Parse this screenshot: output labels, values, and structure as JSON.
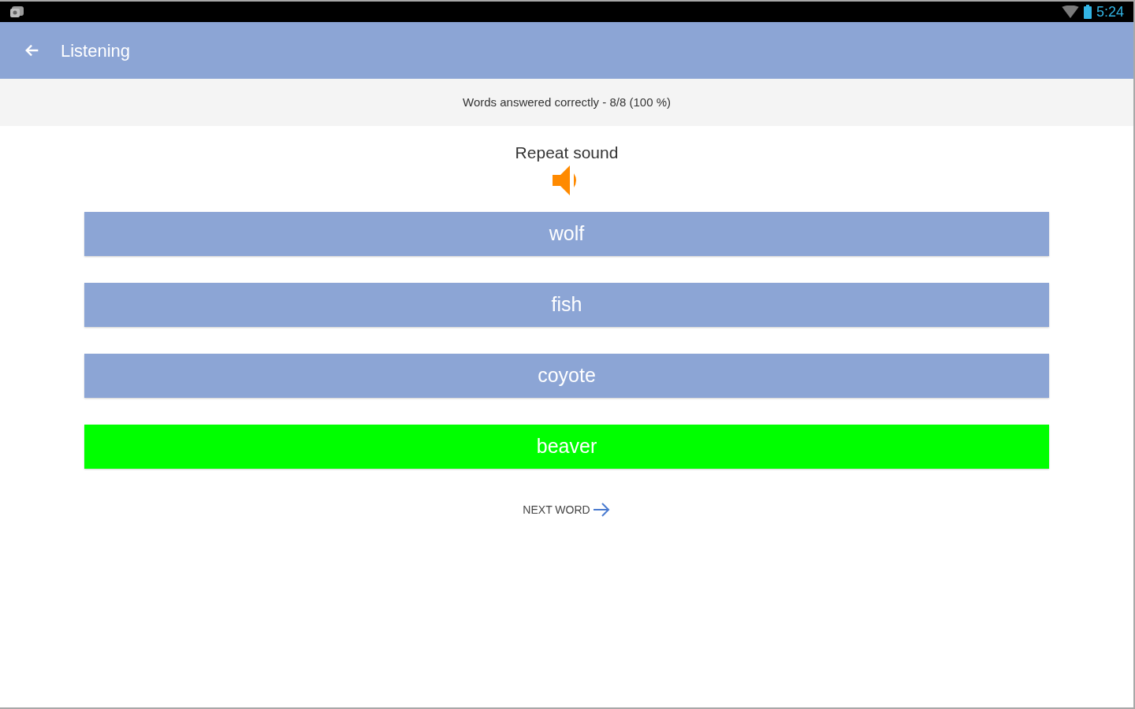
{
  "status_bar": {
    "time": "5:24"
  },
  "app_bar": {
    "title": "Listening"
  },
  "summary": {
    "text": "Words answered correctly - 8/8 (100 %)"
  },
  "repeat": {
    "label": "Repeat sound"
  },
  "options": [
    {
      "label": "wolf",
      "correct": false
    },
    {
      "label": "fish",
      "correct": false
    },
    {
      "label": "coyote",
      "correct": false
    },
    {
      "label": "beaver",
      "correct": true
    }
  ],
  "next": {
    "label": "NEXT WORD"
  }
}
